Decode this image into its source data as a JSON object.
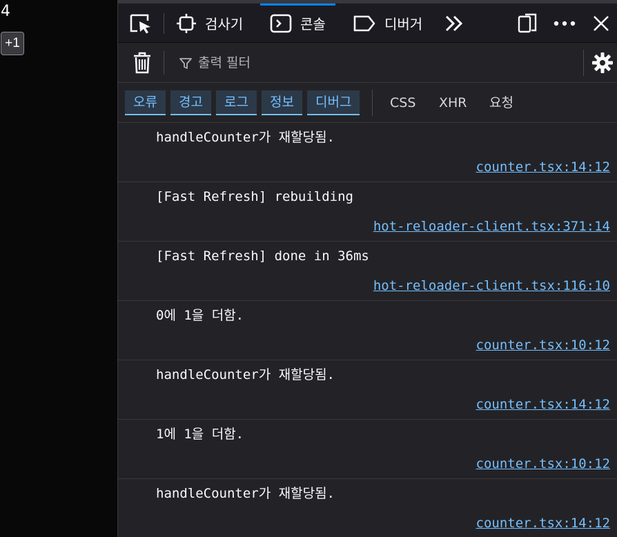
{
  "page": {
    "counter_value": "4",
    "increment_label": "+1"
  },
  "toolbar": {
    "tabs": [
      {
        "label": "검사기",
        "icon": "inspector-icon"
      },
      {
        "label": "콘솔",
        "icon": "console-icon",
        "selected": true
      },
      {
        "label": "디버거",
        "icon": "debugger-icon"
      }
    ],
    "more_label": "»",
    "menu_label": "•••",
    "close_label": "✕"
  },
  "filter": {
    "placeholder": "출력 필터"
  },
  "levels": [
    "오류",
    "경고",
    "로그",
    "정보",
    "디버그"
  ],
  "types": [
    "CSS",
    "XHR",
    "요청"
  ],
  "logs": [
    {
      "message": "handleCounter가 재할당됨.",
      "source": "counter.tsx:14:12"
    },
    {
      "message": "[Fast Refresh] rebuilding",
      "source": "hot-reloader-client.tsx:371:14"
    },
    {
      "message": "[Fast Refresh] done in 36ms",
      "source": "hot-reloader-client.tsx:116:10"
    },
    {
      "message": "0에 1을 더함.",
      "source": "counter.tsx:10:12"
    },
    {
      "message": "handleCounter가 재할당됨.",
      "source": "counter.tsx:14:12"
    },
    {
      "message": "1에 1을 더함.",
      "source": "counter.tsx:10:12"
    },
    {
      "message": "handleCounter가 재할당됨.",
      "source": "counter.tsx:14:12"
    }
  ],
  "colors": {
    "accent": "#0a84ff",
    "link": "#75bfff",
    "background": "#232327"
  }
}
